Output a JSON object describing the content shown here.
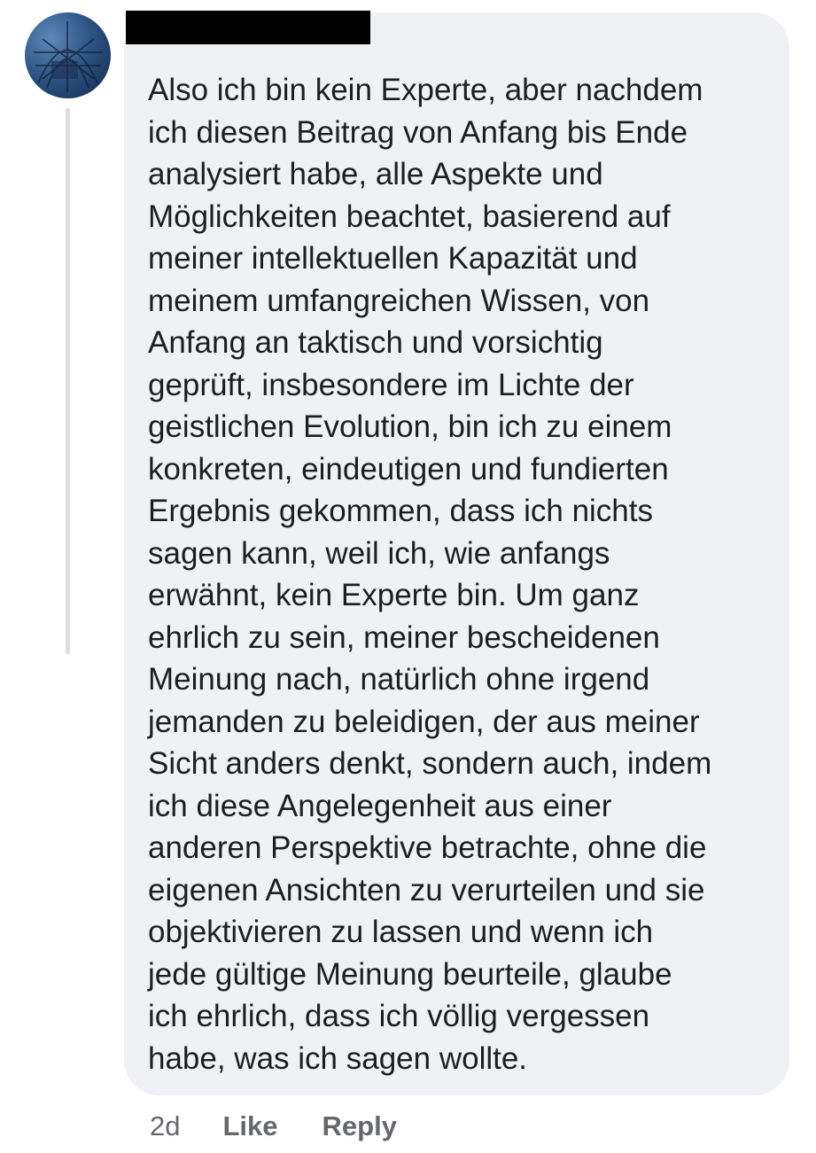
{
  "comment": {
    "author_redacted": "",
    "lines": [
      "Also ich bin kein Experte, aber nachdem",
      "ich diesen Beitrag von Anfang bis Ende",
      "analysiert habe, alle Aspekte und",
      "Möglichkeiten beachtet, basierend auf",
      "meiner intellektuellen Kapazität und",
      "meinem umfangreichen Wissen, von",
      "Anfang an taktisch und vorsichtig",
      "geprüft, insbesondere im Lichte der",
      "geistlichen Evolution, bin ich zu einem",
      "konkreten, eindeutigen und fundierten",
      "Ergebnis gekommen, dass ich nichts",
      "sagen kann, weil ich, wie anfangs",
      "erwähnt, kein Experte bin. Um ganz",
      "ehrlich zu sein, meiner bescheidenen",
      "Meinung nach, natürlich ohne irgend",
      "jemanden zu beleidigen, der aus meiner",
      "Sicht anders denkt, sondern auch, indem",
      "ich diese Angelegenheit aus einer",
      "anderen Perspektive betrachte, ohne die",
      "eigenen Ansichten zu verurteilen und sie",
      "objektivieren zu lassen und wenn ich",
      "jede gültige Meinung beurteile, glaube",
      "ich ehrlich, dass ich völlig vergessen",
      "habe, was ich sagen wollte."
    ]
  },
  "actions": {
    "timestamp": "2d",
    "like_label": "Like",
    "reply_label": "Reply"
  },
  "colors": {
    "bubble_background": "#eff1f4",
    "text": "#1c1e21",
    "secondary_text": "#65676b",
    "redaction": "#000000"
  }
}
